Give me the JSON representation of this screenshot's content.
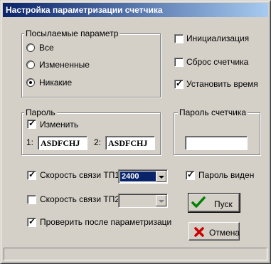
{
  "window": {
    "title": "Настройка параметризации счетчика"
  },
  "send_group": {
    "legend": "Посылаемые параметр",
    "options": [
      "Все",
      "Измененные",
      "Никакие"
    ],
    "selected": "Никакие"
  },
  "right_checks": {
    "init": {
      "label": "Инициализация",
      "checked": false
    },
    "reset": {
      "label": "Сброс счетчика",
      "checked": false
    },
    "settime": {
      "label": "Установить время",
      "checked": true
    }
  },
  "password_group": {
    "legend": "Пароль",
    "change_label": "Изменить",
    "field1_label": "1:",
    "field1_value": "ASDFCHJ",
    "field2_label": "2:",
    "field2_value": "ASDFCHJ"
  },
  "meter_password_group": {
    "legend": "Пароль счетчика",
    "value": ""
  },
  "link1": {
    "label": "Скорость связи ТП1",
    "checked": true,
    "value": "2400"
  },
  "link2": {
    "label": "Скорость связи ТП2",
    "checked": false,
    "value": ""
  },
  "password_visible": {
    "label": "Пароль виден",
    "checked": true
  },
  "verify": {
    "label": "Проверить после параметризаци",
    "checked": true
  },
  "buttons": {
    "start": "Пуск",
    "cancel": "Отмена"
  },
  "colors": {
    "titlebar_start": "#0a246a",
    "titlebar_end": "#a6caf0",
    "face": "#d4d0c8",
    "ok_icon": "#008000",
    "cancel_icon": "#cc0000"
  }
}
